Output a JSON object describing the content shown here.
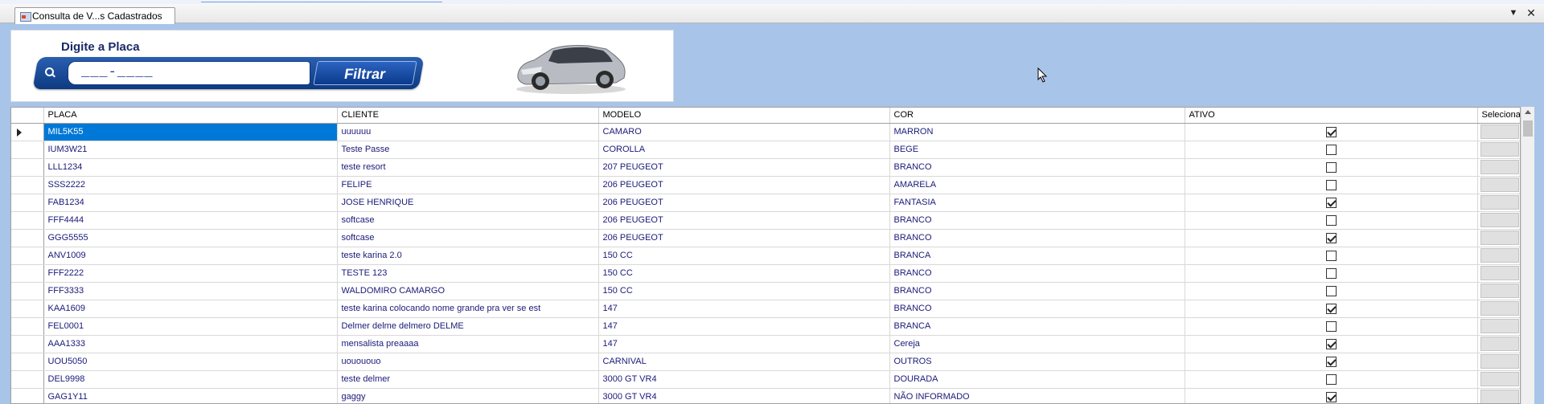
{
  "tab": {
    "title": "Consulta de V...s Cadastrados"
  },
  "filter": {
    "heading": "Digite a Placa",
    "input_value": "___-____",
    "button_label": "Filtrar"
  },
  "grid": {
    "columns": [
      "PLACA",
      "CLIENTE",
      "MODELO",
      "COR",
      "ATIVO",
      "Selecionar"
    ],
    "rows": [
      {
        "placa": "MIL5K55",
        "cliente": "uuuuuu",
        "modelo": "CAMARO",
        "cor": "MARRON",
        "ativo": true
      },
      {
        "placa": "IUM3W21",
        "cliente": "Teste Passe",
        "modelo": "COROLLA",
        "cor": "BEGE",
        "ativo": false
      },
      {
        "placa": "LLL1234",
        "cliente": "teste resort",
        "modelo": "207 PEUGEOT",
        "cor": "BRANCO",
        "ativo": false
      },
      {
        "placa": "SSS2222",
        "cliente": "FELIPE",
        "modelo": "206 PEUGEOT",
        "cor": "AMARELA",
        "ativo": false
      },
      {
        "placa": "FAB1234",
        "cliente": "JOSE HENRIQUE",
        "modelo": "206 PEUGEOT",
        "cor": "FANTASIA",
        "ativo": true
      },
      {
        "placa": "FFF4444",
        "cliente": "softcase",
        "modelo": "206 PEUGEOT",
        "cor": "BRANCO",
        "ativo": false
      },
      {
        "placa": "GGG5555",
        "cliente": "softcase",
        "modelo": "206 PEUGEOT",
        "cor": "BRANCO",
        "ativo": true
      },
      {
        "placa": "ANV1009",
        "cliente": "teste karina 2.0",
        "modelo": "150 CC",
        "cor": "BRANCA",
        "ativo": false
      },
      {
        "placa": "FFF2222",
        "cliente": "TESTE 123",
        "modelo": "150 CC",
        "cor": "BRANCO",
        "ativo": false
      },
      {
        "placa": "FFF3333",
        "cliente": "WALDOMIRO CAMARGO",
        "modelo": "150 CC",
        "cor": "BRANCO",
        "ativo": false
      },
      {
        "placa": "KAA1609",
        "cliente": "teste karina  colocando nome grande pra ver se est",
        "modelo": "147",
        "cor": "BRANCO",
        "ativo": true
      },
      {
        "placa": "FEL0001",
        "cliente": "Delmer delme delmero DELME",
        "modelo": "147",
        "cor": "BRANCA",
        "ativo": false
      },
      {
        "placa": "AAA1333",
        "cliente": "mensalista preaaaa",
        "modelo": "147",
        "cor": "Cereja",
        "ativo": true
      },
      {
        "placa": "UOU5050",
        "cliente": "uouououo",
        "modelo": "CARNIVAL",
        "cor": "OUTROS",
        "ativo": true
      },
      {
        "placa": "DEL9998",
        "cliente": "teste delmer",
        "modelo": "3000 GT VR4",
        "cor": "DOURADA",
        "ativo": false
      },
      {
        "placa": "GAG1Y11",
        "cliente": "gaggy",
        "modelo": "3000 GT VR4",
        "cor": "NÃO INFORMADO",
        "ativo": true
      }
    ]
  }
}
